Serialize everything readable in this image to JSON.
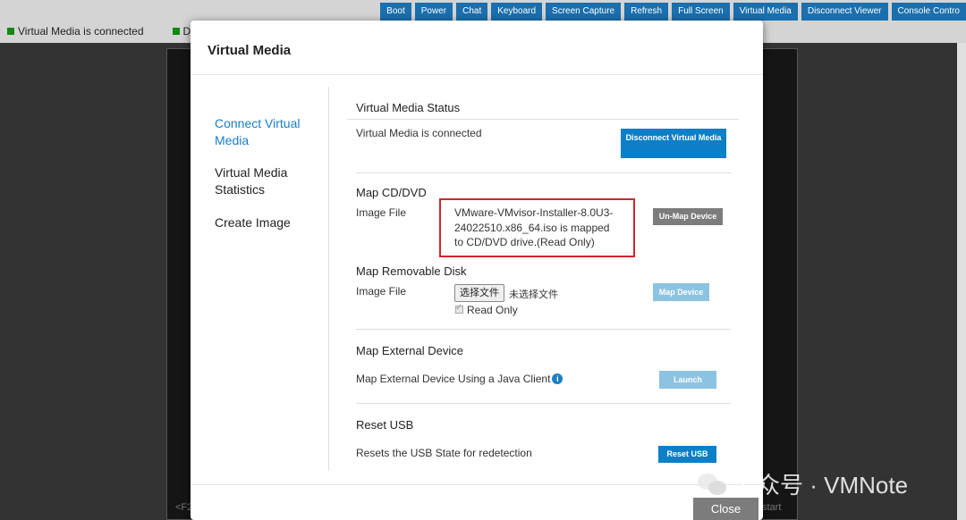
{
  "toolbar": {
    "buttons": [
      "Boot",
      "Power",
      "Chat",
      "Keyboard",
      "Screen Capture",
      "Refresh",
      "Full Screen",
      "Virtual Media",
      "Disconnect Viewer",
      "Console Contro"
    ]
  },
  "status_bar": {
    "virtual_media": "Virtual Media is connected",
    "second": "De",
    "tail": ")"
  },
  "console": {
    "bottom_left": "<F2",
    "bottom_right": "start"
  },
  "modal": {
    "title": "Virtual Media",
    "sidebar": [
      {
        "label": "Connect Virtual Media"
      },
      {
        "label": "Virtual Media Statistics"
      },
      {
        "label": "Create Image"
      }
    ],
    "status": {
      "title": "Virtual Media Status",
      "text": "Virtual Media is connected",
      "button": "Disconnect Virtual Media"
    },
    "cd": {
      "title": "Map CD/DVD",
      "label": "Image File",
      "mapped_text": "VMware-VMvisor-Installer-8.0U3-24022510.x86_64.iso is mapped to CD/DVD drive.(Read Only)",
      "button": "Un-Map Device"
    },
    "removable": {
      "title": "Map Removable Disk",
      "label": "Image File",
      "choose_button": "选择文件",
      "no_file": "未选择文件",
      "read_only_label": "Read Only",
      "read_only_checked": true,
      "button": "Map Device"
    },
    "external": {
      "title": "Map External Device",
      "text": "Map External Device Using a Java Client",
      "button": "Launch"
    },
    "reset": {
      "title": "Reset USB",
      "text": "Resets the USB State for redetection",
      "button": "Reset USB"
    },
    "close_button": "Close"
  },
  "watermark": {
    "text": "公众号 · VMNote"
  },
  "colors": {
    "accent_blue": "#0c7fc6",
    "link_blue": "#1a7ec4",
    "highlight_red": "#d6232b",
    "status_green": "#118811"
  }
}
